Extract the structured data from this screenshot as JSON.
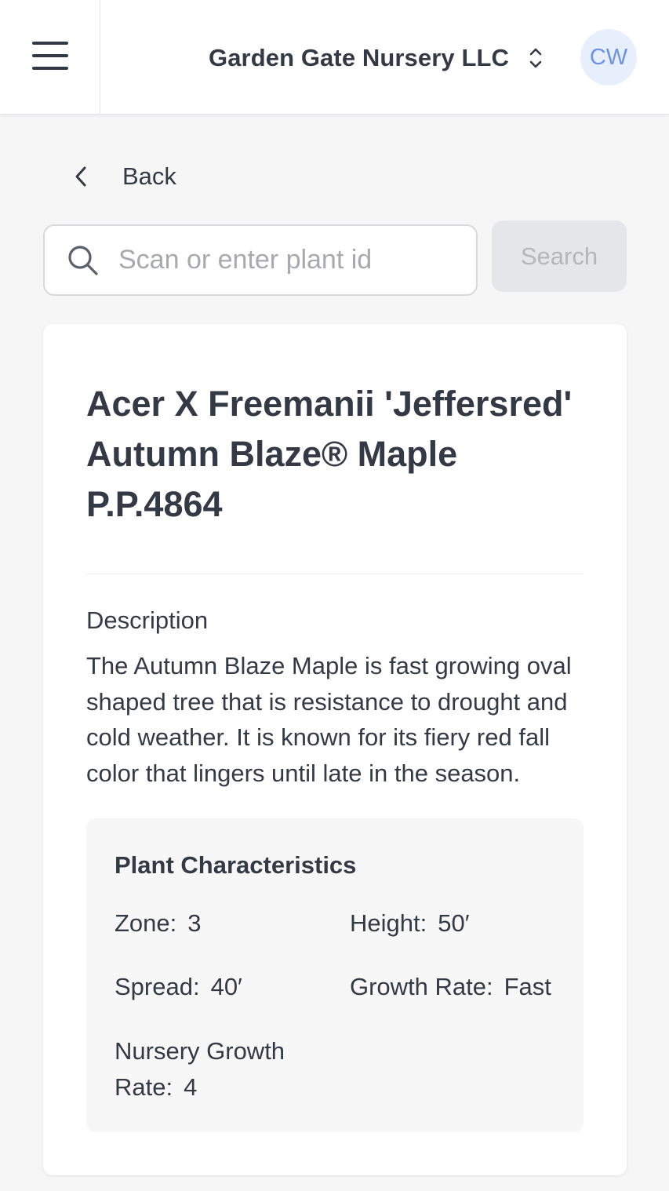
{
  "header": {
    "org_name": "Garden Gate Nursery LLC",
    "avatar_initials": "CW",
    "icons": {
      "menu": "hamburger-menu-icon",
      "org_switch": "chevron-up-down-icon"
    },
    "colors": {
      "avatar_bg": "#e7effd",
      "avatar_text": "#6b93e6"
    }
  },
  "nav": {
    "back_label": "Back"
  },
  "search": {
    "placeholder": "Scan or enter plant id",
    "value": "",
    "button_label": "Search",
    "button_enabled": false
  },
  "plant": {
    "title": "Acer X Freemanii 'Jeffersred' Autumn Blaze® Maple P.P.4864",
    "description_label": "Description",
    "description": "The Autumn Blaze Maple is fast growing oval shaped tree that is resistance to drought and cold weather. It is known for its fiery red fall color that lingers until late in the season.",
    "characteristics": {
      "heading": "Plant Characteristics",
      "zone": {
        "label": "Zone:",
        "value": "3"
      },
      "height": {
        "label": "Height:",
        "value": "50′"
      },
      "spread": {
        "label": "Spread:",
        "value": "40′"
      },
      "growth_rate": {
        "label": "Growth Rate:",
        "value": "Fast"
      },
      "nursery_growth_rate": {
        "label_line1": "Nursery Growth",
        "label_line2": "Rate:",
        "value": "4"
      }
    }
  }
}
